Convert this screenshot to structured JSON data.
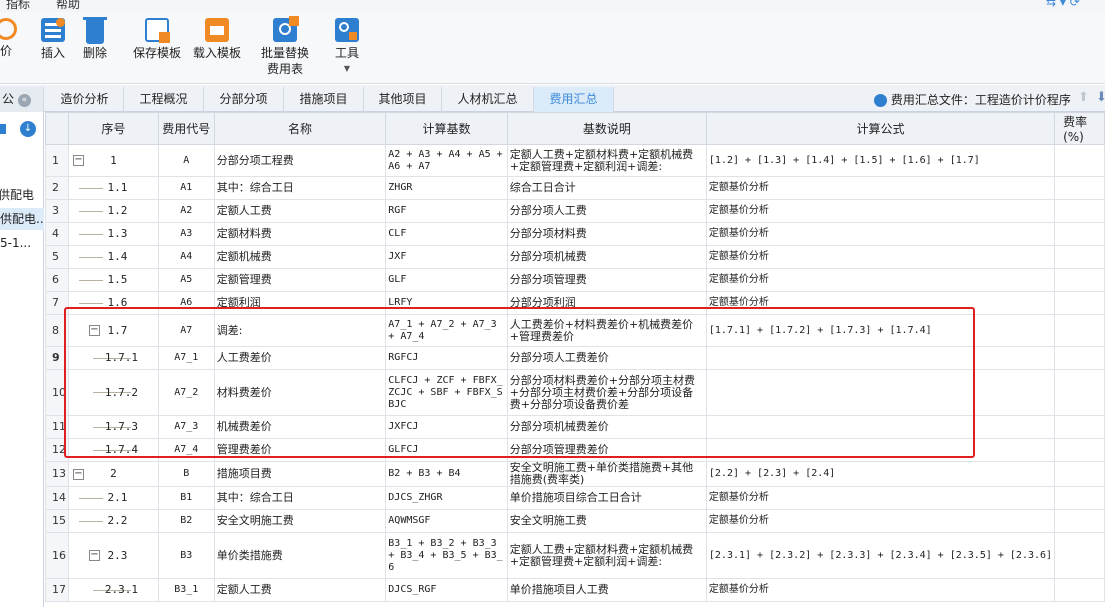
{
  "menu": {
    "item1": "指标",
    "item2": "帮助"
  },
  "toolbar": {
    "partial_label": "询价",
    "insert": "插入",
    "delete": "删除",
    "save_template": "保存模板",
    "load_template": "载入模板",
    "batch_replace_line1": "批量替换",
    "batch_replace_line2": "费用表",
    "tools": "工具"
  },
  "left_panel": {
    "item1": "公",
    "item2": "供配电",
    "item3": "供配电...",
    "item4": "5-1..."
  },
  "tabs": [
    "造价分析",
    "工程概况",
    "分部分项",
    "措施项目",
    "其他项目",
    "人材机汇总",
    "费用汇总"
  ],
  "file_label": "费用汇总文件：工程造价计价程序",
  "columns": [
    "序号",
    "费用代号",
    "名称",
    "计算基数",
    "基数说明",
    "计算公式",
    "费率(%)"
  ],
  "rows": [
    {
      "n": "1",
      "seq": "1",
      "code": "A",
      "name": "分部分项工程费",
      "base": "A2 + A3 + A4 + A5 + A6 + A7",
      "desc": "定额人工费+定额材料费+定额机械费+定额管理费+定额利润+调差:",
      "formula": "[1.2] + [1.3] + [1.4] + [1.5] + [1.6] + [1.7]"
    },
    {
      "n": "2",
      "seq": "1.1",
      "code": "A1",
      "name": "其中：综合工日",
      "base": "ZHGR",
      "desc": "综合工日合计",
      "formula": "定额基价分析"
    },
    {
      "n": "3",
      "seq": "1.2",
      "code": "A2",
      "name": "定额人工费",
      "base": "RGF",
      "desc": "分部分项人工费",
      "formula": "定额基价分析"
    },
    {
      "n": "4",
      "seq": "1.3",
      "code": "A3",
      "name": "定额材料费",
      "base": "CLF",
      "desc": "分部分项材料费",
      "formula": "定额基价分析"
    },
    {
      "n": "5",
      "seq": "1.4",
      "code": "A4",
      "name": "定额机械费",
      "base": "JXF",
      "desc": "分部分项机械费",
      "formula": "定额基价分析"
    },
    {
      "n": "6",
      "seq": "1.5",
      "code": "A5",
      "name": "定额管理费",
      "base": "GLF",
      "desc": "分部分项管理费",
      "formula": "定额基价分析"
    },
    {
      "n": "7",
      "seq": "1.6",
      "code": "A6",
      "name": "定额利润",
      "base": "LRFY",
      "desc": "分部分项利润",
      "formula": "定额基价分析"
    },
    {
      "n": "8",
      "seq": "1.7",
      "code": "A7",
      "name": "调差:",
      "base": "A7_1 + A7_2 + A7_3 + A7_4",
      "desc": "人工费差价+材料费差价+机械费差价+管理费差价",
      "formula": "[1.7.1] + [1.7.2] + [1.7.3] + [1.7.4]"
    },
    {
      "n": "9",
      "seq": "1.7.1",
      "code": "A7_1",
      "name": "人工费差价",
      "base": "RGFCJ",
      "desc": "分部分项人工费差价",
      "formula": ""
    },
    {
      "n": "10",
      "seq": "1.7.2",
      "code": "A7_2",
      "name": "材料费差价",
      "base": "CLFCJ + ZCF + FBFX_ZCJC + SBF + FBFX_SBJC",
      "desc": "分部分项材料费差价+分部分项主材费+分部分项主材费价差+分部分项设备费+分部分项设备费价差",
      "formula": ""
    },
    {
      "n": "11",
      "seq": "1.7.3",
      "code": "A7_3",
      "name": "机械费差价",
      "base": "JXFCJ",
      "desc": "分部分项机械费差价",
      "formula": ""
    },
    {
      "n": "12",
      "seq": "1.7.4",
      "code": "A7_4",
      "name": "管理费差价",
      "base": "GLFCJ",
      "desc": "分部分项管理费差价",
      "formula": ""
    },
    {
      "n": "13",
      "seq": "2",
      "code": "B",
      "name": "措施项目费",
      "base": "B2 + B3 + B4",
      "desc": "安全文明施工费+单价类措施费+其他措施费(费率类)",
      "formula": "[2.2] + [2.3] + [2.4]"
    },
    {
      "n": "14",
      "seq": "2.1",
      "code": "B1",
      "name": "其中：综合工日",
      "base": "DJCS_ZHGR",
      "desc": "单价措施项目综合工日合计",
      "formula": "定额基价分析"
    },
    {
      "n": "15",
      "seq": "2.2",
      "code": "B2",
      "name": "安全文明施工费",
      "base": "AQWMSGF",
      "desc": "安全文明施工费",
      "formula": "定额基价分析"
    },
    {
      "n": "16",
      "seq": "2.3",
      "code": "B3",
      "name": "单价类措施费",
      "base": "B3_1 + B3_2 + B3_3 + B3_4 + B3_5 + B3_6",
      "desc": "定额人工费+定额材料费+定额机械费+定额管理费+定额利润+调差:",
      "formula": "[2.3.1] + [2.3.2] + [2.3.3] + [2.3.4] + [2.3.5] + [2.3.6]"
    },
    {
      "n": "17",
      "seq": "2.3.1",
      "code": "B3_1",
      "name": "定额人工费",
      "base": "DJCS_RGF",
      "desc": "单价措施项目人工费",
      "formula": "定额基价分析"
    }
  ],
  "colors": {
    "accent": "#3c8ad8",
    "highlight": "#e02020",
    "toolbar_blue": "#2f7fd0",
    "toolbar_orange": "#f08a24"
  }
}
